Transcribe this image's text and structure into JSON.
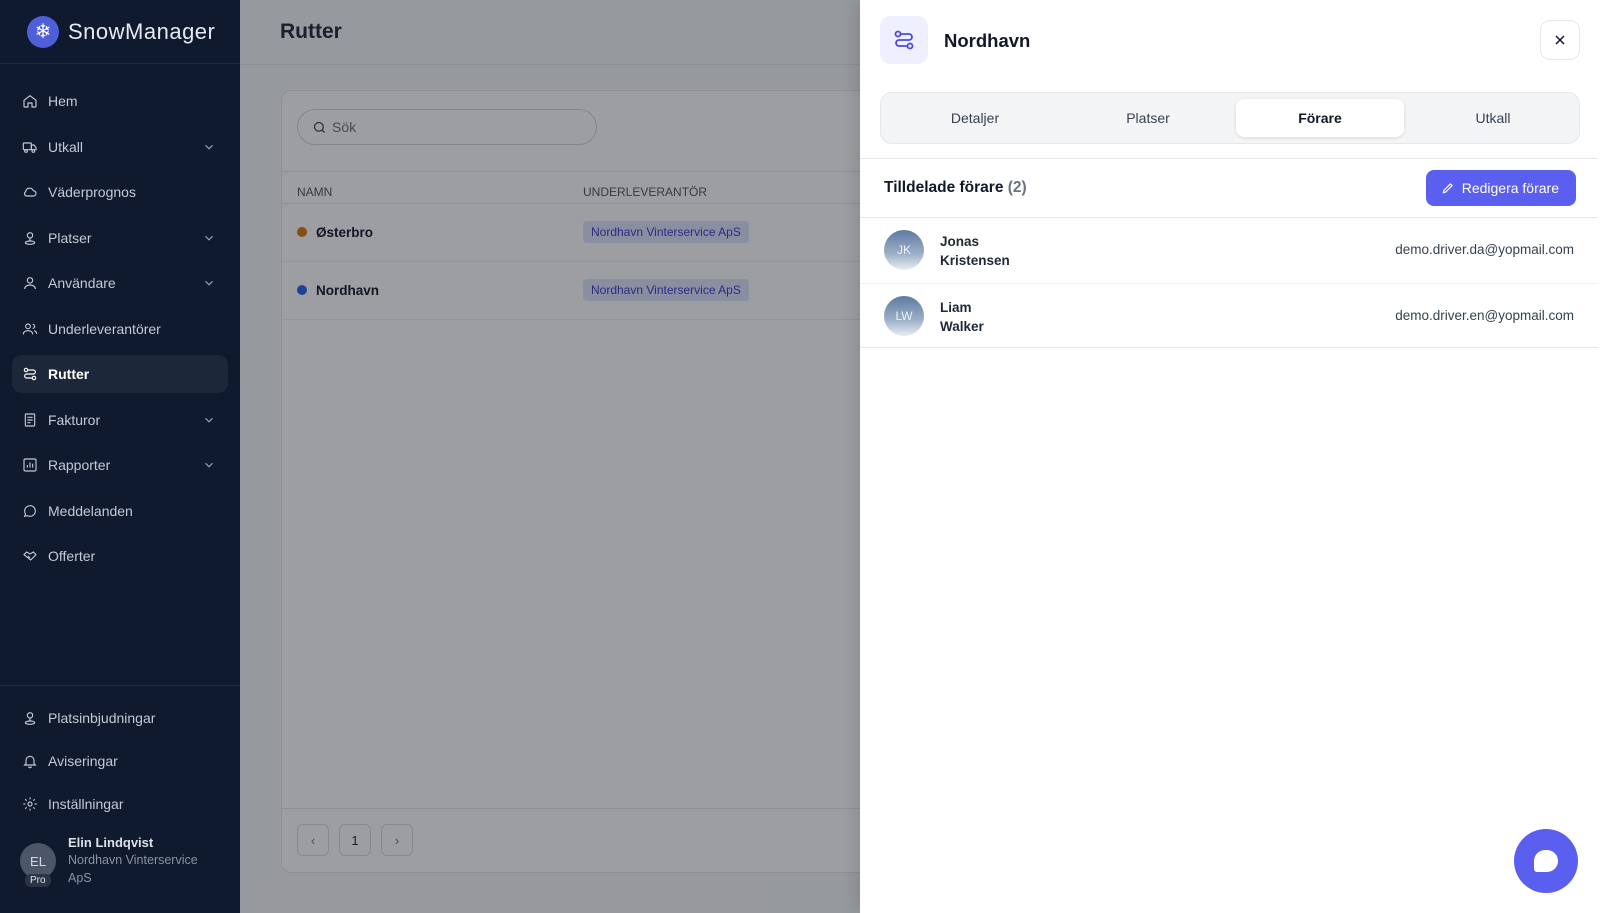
{
  "brand": {
    "name": "SnowManager",
    "logo_glyph": "❄"
  },
  "sidebar": {
    "items": [
      {
        "label": "Hem",
        "icon": "home-icon",
        "chevron": false
      },
      {
        "label": "Utkall",
        "icon": "truck-icon",
        "chevron": true
      },
      {
        "label": "Väderprognos",
        "icon": "cloud-icon",
        "chevron": false
      },
      {
        "label": "Platser",
        "icon": "location-icon",
        "chevron": true
      },
      {
        "label": "Användare",
        "icon": "user-icon",
        "chevron": true
      },
      {
        "label": "Underleverantörer",
        "icon": "users-icon",
        "chevron": false
      },
      {
        "label": "Rutter",
        "icon": "route-icon",
        "chevron": false,
        "active": true
      },
      {
        "label": "Fakturor",
        "icon": "invoice-icon",
        "chevron": true
      },
      {
        "label": "Rapporter",
        "icon": "chart-icon",
        "chevron": true
      },
      {
        "label": "Meddelanden",
        "icon": "message-icon",
        "chevron": false
      },
      {
        "label": "Offerter",
        "icon": "handshake-icon",
        "chevron": false
      }
    ],
    "bottom_items": [
      {
        "label": "Platsinbjudningar",
        "icon": "location-invite-icon"
      },
      {
        "label": "Aviseringar",
        "icon": "bell-icon"
      },
      {
        "label": "Inställningar",
        "icon": "gear-icon"
      }
    ],
    "user": {
      "initials": "EL",
      "badge": "Pro",
      "name": "Elin Lindqvist",
      "company": "Nordhavn Vinterservice ApS"
    }
  },
  "main": {
    "title": "Rutter",
    "search": {
      "placeholder": "Sök"
    },
    "columns": [
      "NAMN",
      "UNDERLEVERANTÖR"
    ],
    "rows": [
      {
        "name": "Østerbro",
        "dot_color": "#d97706",
        "subcontractor": "Nordhavn Vinterservice ApS"
      },
      {
        "name": "Nordhavn",
        "dot_color": "#2563eb",
        "subcontractor": "Nordhavn Vinterservice ApS"
      }
    ],
    "pagination": {
      "prev": "‹",
      "page": "1",
      "next": "›"
    }
  },
  "drawer": {
    "title": "Nordhavn",
    "tabs": [
      "Detaljer",
      "Platser",
      "Förare",
      "Utkall"
    ],
    "active_tab": "Förare",
    "section": {
      "title": "Tilldelade förare",
      "count": "(2)",
      "edit_label": "Redigera förare"
    },
    "drivers": [
      {
        "initials": "JK",
        "first": "Jonas",
        "last": "Kristensen",
        "email": "demo.driver.da@yopmail.com"
      },
      {
        "initials": "LW",
        "first": "Liam",
        "last": "Walker",
        "email": "demo.driver.en@yopmail.com"
      }
    ]
  },
  "colors": {
    "accent": "#5b5ff0",
    "sidebar_bg": "#0f1a2e"
  }
}
